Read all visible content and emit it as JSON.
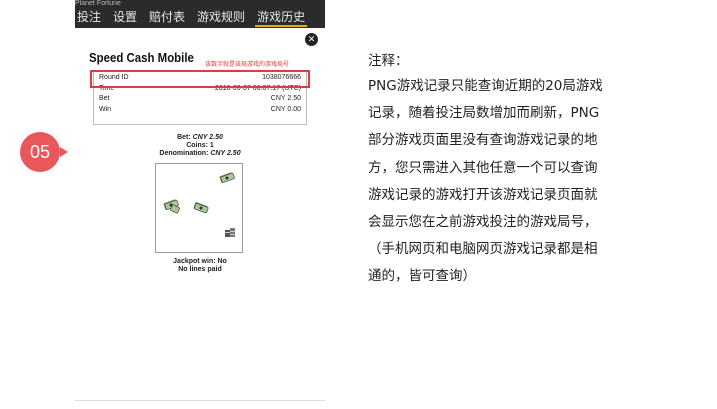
{
  "step": {
    "number": "05",
    "color": "#e8575a"
  },
  "app": {
    "title": "Planet Fortune",
    "tabs": [
      {
        "label": "投注",
        "active": false
      },
      {
        "label": "设置",
        "active": false
      },
      {
        "label": "赔付表",
        "active": false
      },
      {
        "label": "游戏规则",
        "active": false
      },
      {
        "label": "游戏历史",
        "active": true
      }
    ]
  },
  "history": {
    "close_icon": "close-icon",
    "game_name": "Speed Cash Mobile",
    "annotation": "该数字就是该局游戏的游戏局号",
    "rows": [
      {
        "label": "Round ID",
        "value": "1038076666"
      },
      {
        "label": "Time",
        "value": "2018-03-07 06:07:17 (UTC)"
      },
      {
        "label": "Bet",
        "value": "CNY 2.50"
      },
      {
        "label": "Win",
        "value": "CNY 0.00"
      }
    ],
    "summary": {
      "bet_label": "Bet:",
      "bet_value": "CNY 2.50",
      "coins": "Coins: 1",
      "denomination_label": "Denomination:",
      "denomination_value": "CNY 2.50"
    },
    "reel_symbols": [
      "cash-bundle-icon",
      "cash-bundle-icon",
      "cash-bundle-icon",
      "cash-bundle-icon",
      "coin-stack-icon"
    ],
    "jackpot": "Jackpot win: No",
    "lines": "No lines paid"
  },
  "notes": {
    "heading": "注释：",
    "lines": [
      "PNG游戏记录只能查询近期的20局游戏",
      "记录，随着投注局数增加而刷新，PNG",
      "部分游戏页面里没有查询游戏记录的地",
      "方，您只需进入其他任意一个可以查询",
      "游戏记录的游戏打开该游戏记录页面就",
      "会显示您在之前游戏投注的游戏局号，",
      "（手机网页和电脑网页游戏记录都是相",
      "通的，皆可查询）"
    ]
  }
}
